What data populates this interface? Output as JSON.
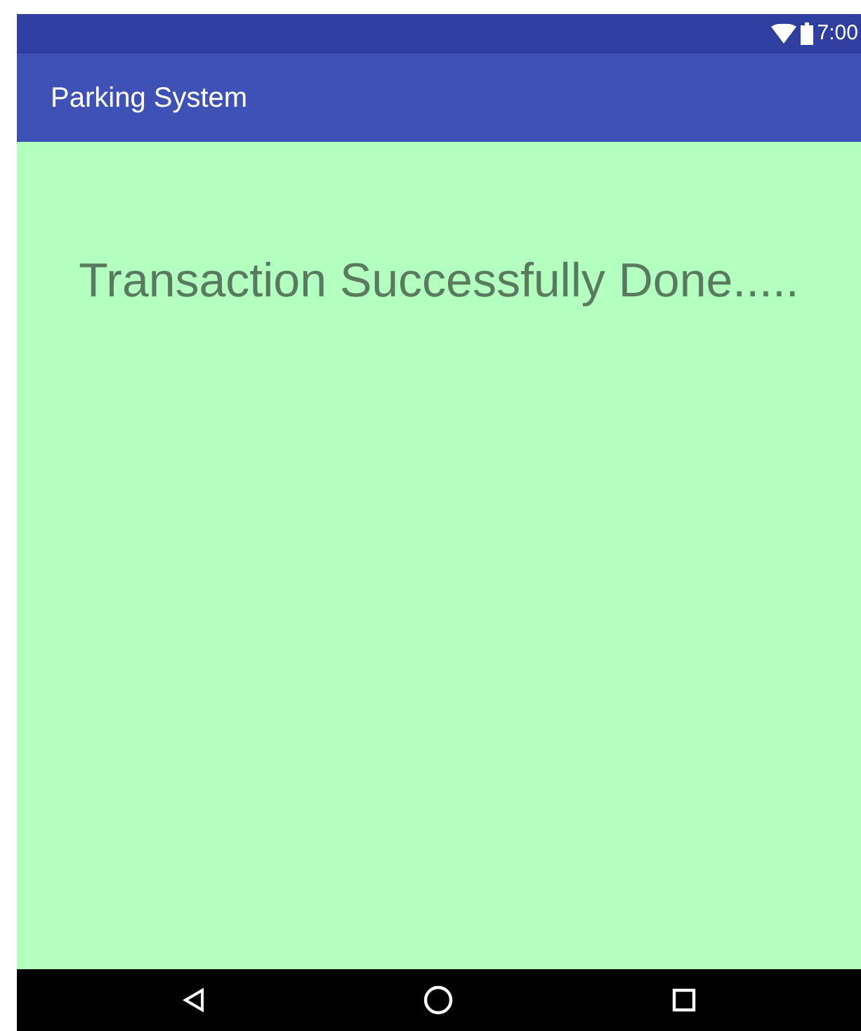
{
  "status_bar": {
    "time": "7:00"
  },
  "app_bar": {
    "title": "Parking System"
  },
  "message": "Transaction Successfully Done.....",
  "nav_bar": {
    "buttons": [
      {
        "kind": "back"
      },
      {
        "kind": "home"
      },
      {
        "kind": "recents"
      }
    ]
  }
}
